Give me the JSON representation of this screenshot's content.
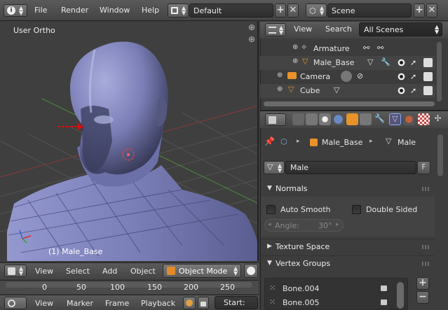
{
  "topbar": {
    "menu": [
      "File",
      "Render",
      "Window",
      "Help"
    ],
    "screen_layout": "Default",
    "scene": "Scene"
  },
  "viewport": {
    "view_label": "User Ortho",
    "object_label": "(1) Male_Base"
  },
  "view3d_header": {
    "menu": [
      "View",
      "Select",
      "Add",
      "Object"
    ],
    "mode": "Object Mode"
  },
  "timeline": {
    "ticks": [
      "0",
      "50",
      "100",
      "150",
      "200",
      "250"
    ],
    "menu": [
      "View",
      "Marker",
      "Frame",
      "Playback"
    ],
    "start_label": "Start:"
  },
  "outliner": {
    "menu": [
      "View",
      "Search"
    ],
    "filter": "All Scenes",
    "rows": [
      {
        "name": "Armature"
      },
      {
        "name": "Male_Base"
      },
      {
        "name": "Camera"
      },
      {
        "name": "Cube"
      }
    ]
  },
  "properties": {
    "breadcrumb": {
      "object": "Male_Base",
      "mesh": "Male"
    },
    "mesh_name": "Male",
    "fake_user": "F",
    "normals": {
      "title": "Normals",
      "auto_smooth": "Auto Smooth",
      "double_sided": "Double Sided",
      "angle_label": "Angle:",
      "angle_value": "30°"
    },
    "texture_space": "Texture Space",
    "vertex_groups": {
      "title": "Vertex Groups",
      "items": [
        "Bone.004",
        "Bone.005"
      ]
    }
  },
  "colors": {
    "panel_bg": "#3d3d3d",
    "viewport_bg": "#3f3f3f",
    "mesh": "#8a8ec6",
    "selection_orange": "#f0a030"
  }
}
